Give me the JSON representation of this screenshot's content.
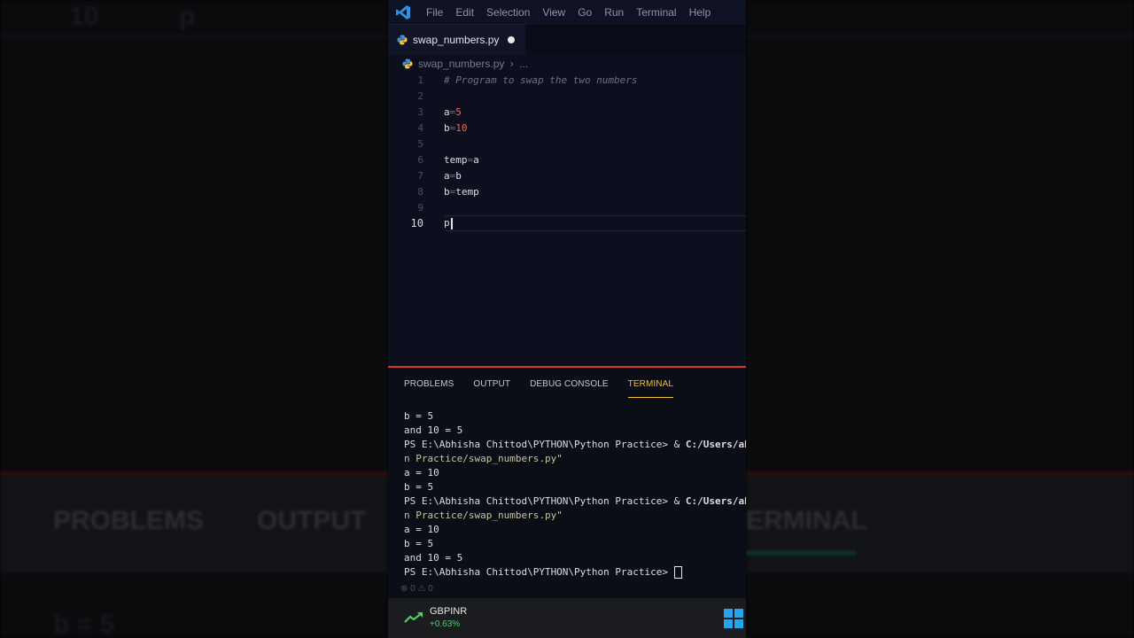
{
  "background": {
    "left_top_text": "10",
    "left_top_char": "p",
    "problems": "PROBLEMS",
    "output": "OUTPUT",
    "left_bottom_text": "b = 5",
    "right_terminal": "ERMINAL"
  },
  "menubar": {
    "items": [
      "File",
      "Edit",
      "Selection",
      "View",
      "Go",
      "Run",
      "Terminal",
      "Help"
    ]
  },
  "tab": {
    "label": "swap_numbers.py"
  },
  "breadcrumb": {
    "file": "swap_numbers.py",
    "more": "..."
  },
  "editor": {
    "lines": [
      {
        "n": "1",
        "comment": "# Program to swap the two numbers"
      },
      {
        "n": "2"
      },
      {
        "n": "3",
        "ident": "a",
        "op": "=",
        "val": "5"
      },
      {
        "n": "4",
        "ident": "b",
        "op": "=",
        "val": "10"
      },
      {
        "n": "5"
      },
      {
        "n": "6",
        "ident": "temp",
        "op": "=",
        "rhs": "a"
      },
      {
        "n": "7",
        "ident": "a",
        "op": "=",
        "rhs": "b"
      },
      {
        "n": "8",
        "ident": "b",
        "op": "=",
        "rhs": "temp"
      },
      {
        "n": "9"
      },
      {
        "n": "10",
        "ident": "p"
      }
    ]
  },
  "panel": {
    "tabs": [
      "PROBLEMS",
      "OUTPUT",
      "DEBUG CONSOLE",
      "TERMINAL"
    ],
    "active_tab": "TERMINAL"
  },
  "terminal": {
    "lines": [
      {
        "text": "b = 5"
      },
      {
        "text": "and 10 = 5"
      },
      {
        "prompt": "PS E:\\Abhisha Chittod\\PYTHON\\Python Practice> & ",
        "cmd": "C:/Users/ab"
      },
      {
        "str": "n Practice/swap_numbers.py\""
      },
      {
        "text": "a = 10"
      },
      {
        "text": "b = 5"
      },
      {
        "prompt": "PS E:\\Abhisha Chittod\\PYTHON\\Python Practice> & ",
        "cmd": "C:/Users/ab"
      },
      {
        "str": "n Practice/swap_numbers.py\""
      },
      {
        "text": "a = 10"
      },
      {
        "text": "b = 5"
      },
      {
        "text": "and 10 = 5"
      },
      {
        "prompt": "PS E:\\Abhisha Chittod\\PYTHON\\Python Practice> ",
        "caret": true
      }
    ]
  },
  "status": {
    "errors": "0",
    "warnings": "0"
  },
  "taskbar": {
    "ticker": "GBPINR",
    "change": "+0.63%"
  },
  "colors": {
    "accent": "#f1c232",
    "panel_border": "#d6382f",
    "windows_blue": "#29a3ec"
  }
}
